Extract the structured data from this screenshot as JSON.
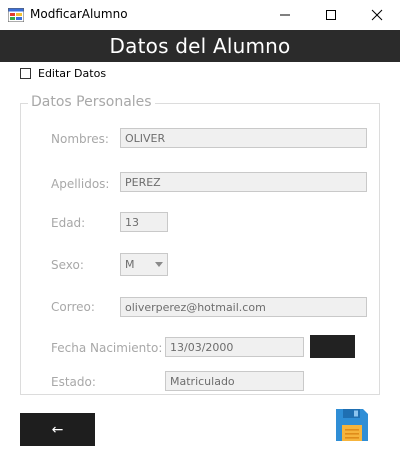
{
  "window": {
    "title": "ModficarAlumno"
  },
  "header": {
    "title": "Datos del Alumno"
  },
  "edit": {
    "label": "Editar Datos",
    "checked": false
  },
  "group": {
    "title": "Datos Personales"
  },
  "fields": {
    "nombres": {
      "label": "Nombres:",
      "value": "OLIVER"
    },
    "apellidos": {
      "label": "Apellidos:",
      "value": "PEREZ"
    },
    "edad": {
      "label": "Edad:",
      "value": "13"
    },
    "sexo": {
      "label": "Sexo:",
      "value": "M"
    },
    "correo": {
      "label": "Correo:",
      "value": "oliverperez@hotmail.com"
    },
    "fecha": {
      "label": "Fecha Nacimiento:",
      "value": "13/03/2000"
    },
    "estado": {
      "label": "Estado:",
      "value": "Matriculado"
    }
  },
  "buttons": {
    "back_label": "←"
  },
  "icons": {
    "save": "floppy-disk-icon",
    "app": "form-app-icon"
  },
  "colors": {
    "header_bg": "#2b2b2b",
    "save_blue": "#2f8ed6",
    "save_orange": "#f6b43c"
  }
}
